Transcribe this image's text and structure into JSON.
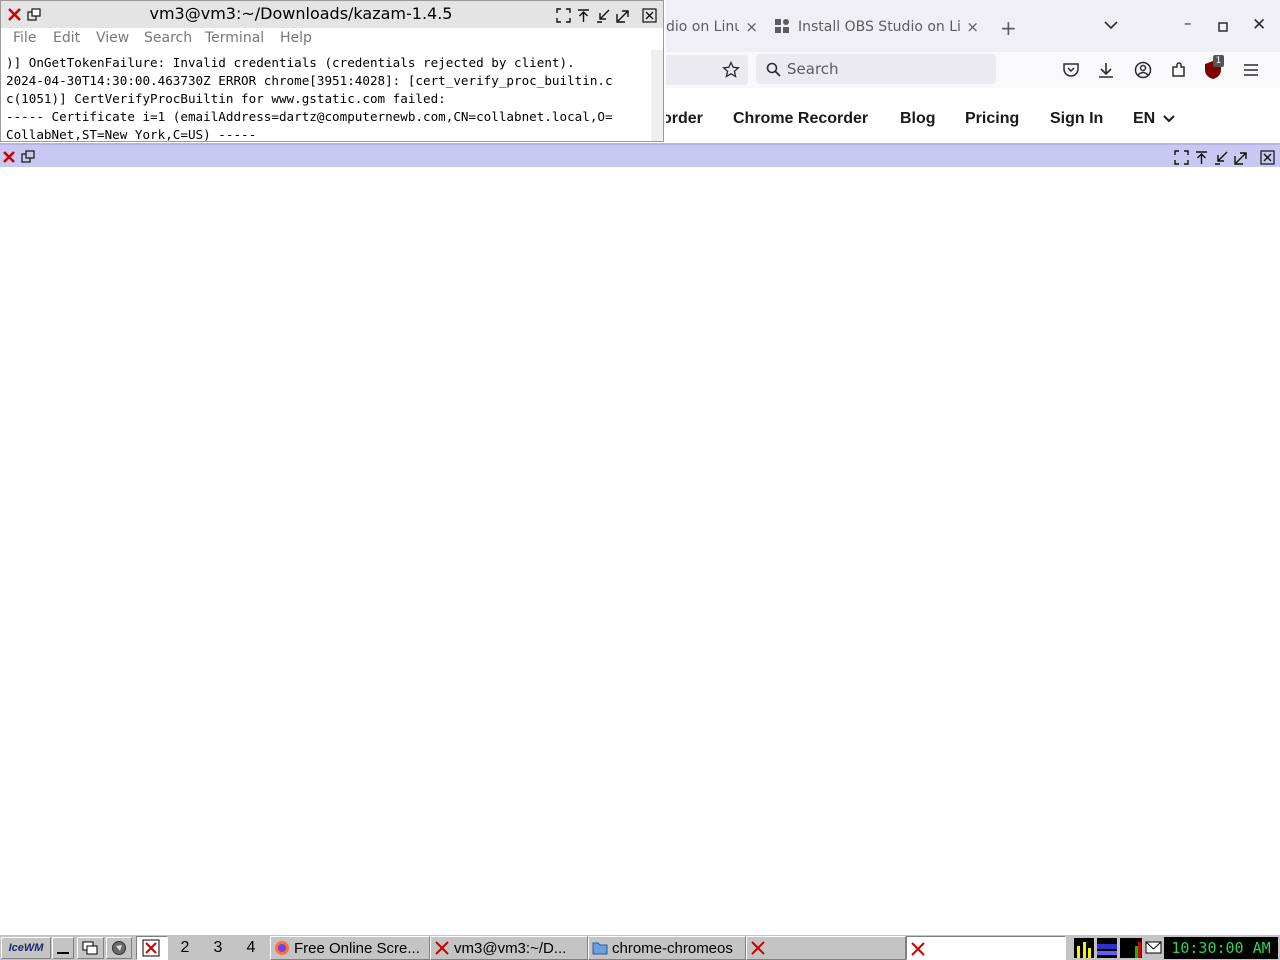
{
  "firefox": {
    "tabs": [
      {
        "label": "dio on Linu"
      },
      {
        "label": "Install OBS Studio on Linu"
      }
    ],
    "new_tab_symbol": "+",
    "search_placeholder": "Search",
    "extension_badge": "1",
    "nav_links": [
      "order",
      "Chrome Recorder",
      "Blog",
      "Pricing",
      "Sign In"
    ],
    "language": "EN"
  },
  "terminal": {
    "title": "vm3@vm3:~/Downloads/kazam-1.4.5",
    "menu": [
      "File",
      "Edit",
      "View",
      "Search",
      "Terminal",
      "Help"
    ],
    "lines": [
      ")] OnGetTokenFailure: Invalid credentials (credentials rejected by client).",
      "2024-04-30T14:30:00.463730Z ERROR chrome[3951:4028]: [cert_verify_proc_builtin.c",
      "c(1051)] CertVerifyProcBuiltin for www.gstatic.com failed:",
      "----- Certificate i=1 (emailAddress=dartz@computernewb.com,CN=collabnet.local,O=",
      "CollabNet,ST=New York,C=US) -----"
    ]
  },
  "taskbar": {
    "start_label": "IceWM",
    "workspaces": [
      "2",
      "3",
      "4"
    ],
    "tasks": [
      {
        "label": "Free Online Scre...",
        "icon": "firefox-icon"
      },
      {
        "label": "vm3@vm3:~/D...",
        "icon": "x-terminal-icon"
      },
      {
        "label": "chrome-chromeos",
        "icon": "folder-icon"
      },
      {
        "label": "",
        "icon": "x-app-icon"
      }
    ],
    "clock": "10:30:00 AM"
  },
  "colors": {
    "inactive_titlebar": "#c8c8f0",
    "wm_close": "#cc0000",
    "clock_text": "#2fd15a"
  }
}
